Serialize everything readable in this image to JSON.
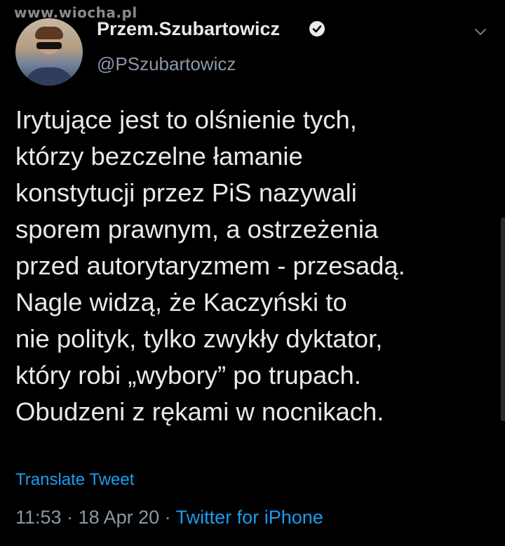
{
  "watermark": "www.wiocha.pl",
  "user": {
    "display_name": "Przem.Szubartowicz",
    "handle": "@PSzubartowicz",
    "verified": true,
    "avatar_icon": "user-photo",
    "menu_icon": "chevron-down-icon"
  },
  "tweet": {
    "text": "Irytujące jest to olśnienie tych,\nktórzy bezczelne łamanie\nkonstytucji przez PiS nazywali\nsporem prawnym, a ostrzeżenia\nprzed autorytaryzmem - przesadą.\nNagle widzą, że Kaczyński to\nnie polityk, tylko zwykły dyktator,\nktóry robi „wybory” po trupach.\nObudzeni z rękami w nocnikach.",
    "translate_label": "Translate Tweet",
    "time": "11:53",
    "separator1": " · ",
    "date": "18 Apr 20",
    "separator2": " · ",
    "source": "Twitter for iPhone"
  },
  "colors": {
    "background": "#000000",
    "text": "#e7e9ea",
    "secondary": "#8b98a5",
    "link": "#1d9bf0"
  }
}
